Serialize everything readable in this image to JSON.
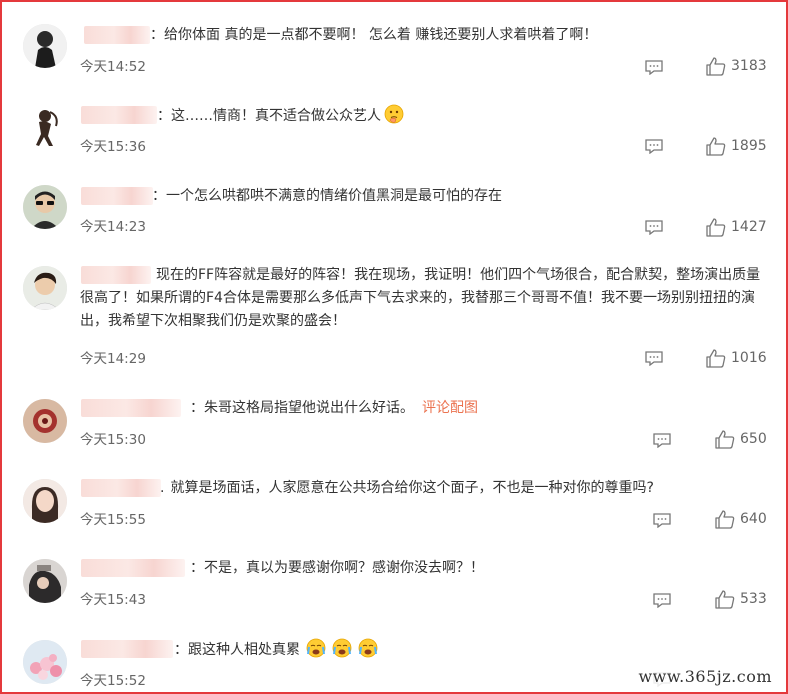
{
  "comments": [
    {
      "prefix": "：",
      "text": "给你体面 真的是一点都不要啊！ 怎么着 赚钱还要别人求着哄着了啊！",
      "time": "今天14:52",
      "likes": "3183"
    },
    {
      "prefix": "：",
      "text": "这……情商！真不适合做公众艺人",
      "time": "今天15:36",
      "likes": "1895"
    },
    {
      "prefix": "：",
      "text": "一个怎么哄都哄不满意的情绪价值黑洞是最可怕的存在",
      "time": "今天14:23",
      "likes": "1427"
    },
    {
      "prefix": "",
      "text": "现在的FF阵容就是最好的阵容！我在现场，我证明！他们四个气场很合，配合默契，整场演出质量很高了！如果所谓的F4合体是需要那么多低声下气去求来的，我替那三个哥哥不值！我不要一场别别扭扭的演出，我希望下次相聚我们仍是欢聚的盛会！",
      "time": "今天14:29",
      "likes": "1016"
    },
    {
      "prefix": "：",
      "text": "朱哥这格局指望他说出什么好话。",
      "link": "评论配图",
      "time": "今天15:30",
      "likes": "650"
    },
    {
      "prefix": "",
      "text": "就算是场面话，人家愿意在公共场合给你这个面子，不也是一种对你的尊重吗?",
      "time": "今天15:55",
      "likes": "640"
    },
    {
      "prefix": "：",
      "text": "不是，真以为要感谢你啊？感谢你没去啊？！",
      "time": "今天15:43",
      "likes": "533"
    },
    {
      "prefix": "：",
      "text": "跟这种人相处真累",
      "time": "今天15:52",
      "likes": ""
    }
  ],
  "watermark": "www.365jz.com",
  "colors": {
    "border": "#e4393c",
    "link": "#eb7350"
  },
  "icons": {
    "reply": "comment-icon",
    "like": "thumbs-up-icon",
    "emoji_thinking": "thinking-face-emoji",
    "emoji_crying": "crying-face-emoji"
  }
}
